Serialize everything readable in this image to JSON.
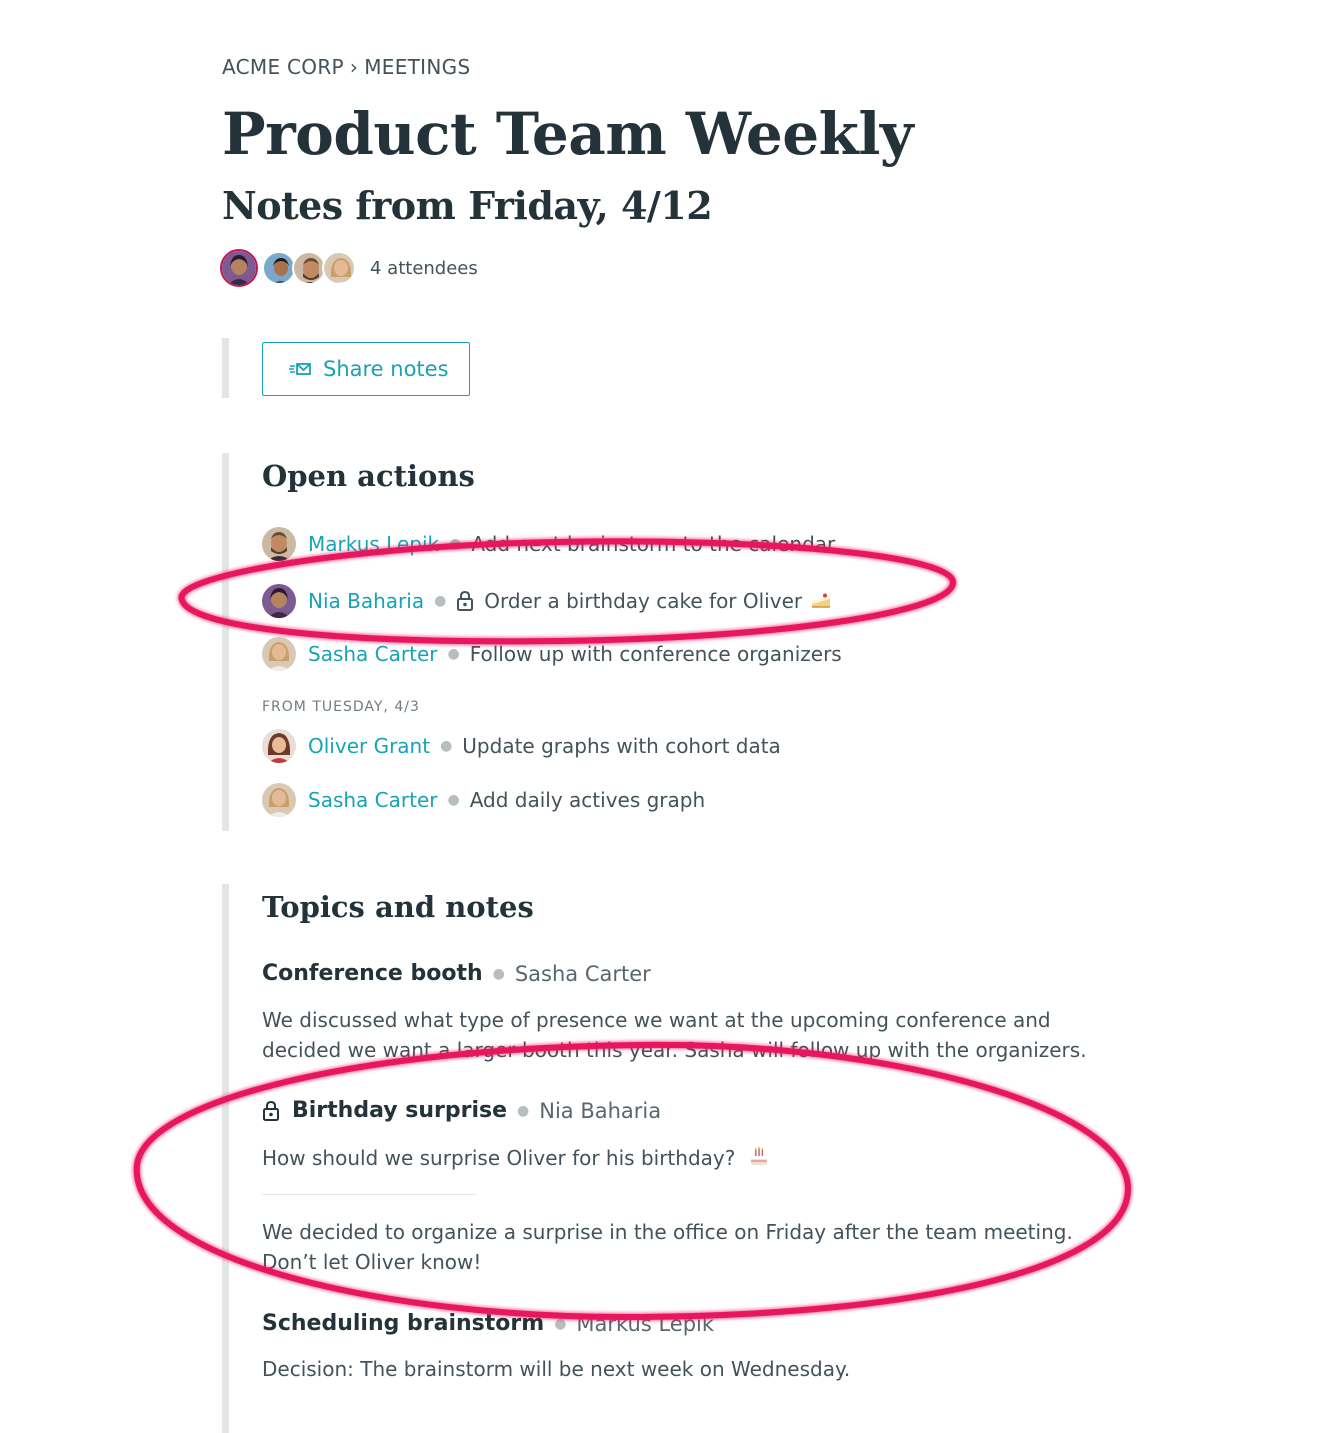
{
  "breadcrumb": {
    "org": "ACME CORP",
    "separator": "›",
    "section": "MEETINGS"
  },
  "meeting": {
    "title": "Product Team Weekly",
    "subtitle": "Notes from Friday, 4/12"
  },
  "attendees": {
    "count_label": "4 attendees",
    "avatars": [
      "Nia Baharia",
      "attendee-2",
      "Markus Lepik",
      "Sasha Carter"
    ]
  },
  "share": {
    "label": "Share notes",
    "icon": "send-mail-icon"
  },
  "open_actions": {
    "title": "Open actions",
    "items": [
      {
        "person": "Markus Lepik",
        "text": "Add next brainstorm to the calendar",
        "private": false
      },
      {
        "person": "Nia Baharia",
        "text": "Order a birthday cake for Oliver",
        "private": true,
        "emoji": "cake-slice-emoji"
      },
      {
        "person": "Sasha Carter",
        "text": "Follow up with conference organizers",
        "private": false
      }
    ],
    "previous_group": {
      "label": "FROM TUESDAY, 4/3",
      "items": [
        {
          "person": "Oliver Grant",
          "text": "Update graphs with cohort data"
        },
        {
          "person": "Sasha Carter",
          "text": "Add daily actives graph"
        }
      ]
    }
  },
  "topics": {
    "title": "Topics and notes",
    "items": [
      {
        "title": "Conference booth",
        "owner": "Sasha Carter",
        "private": false,
        "body": "We discussed what type of presence we want at the upcoming conference and decided we want a larger booth this year. Sasha will follow up with the organizers."
      },
      {
        "title": "Birthday surprise",
        "owner": "Nia Baharia",
        "private": true,
        "question": "How should we surprise Oliver for his birthday?",
        "emoji": "birthday-cake-emoji",
        "body": "We decided to organize a surprise in the office on Friday after the team meeting. Don’t let Oliver know!"
      },
      {
        "title": "Scheduling brainstorm",
        "owner": "Markus Lepik",
        "private": false,
        "body": "Decision: The brainstorm will be next week on Wednesday."
      }
    ]
  },
  "colors": {
    "accent": "#18a3b5",
    "annotation": "#e8175d",
    "heading": "#24323a",
    "rule": "#e3e6e8"
  }
}
